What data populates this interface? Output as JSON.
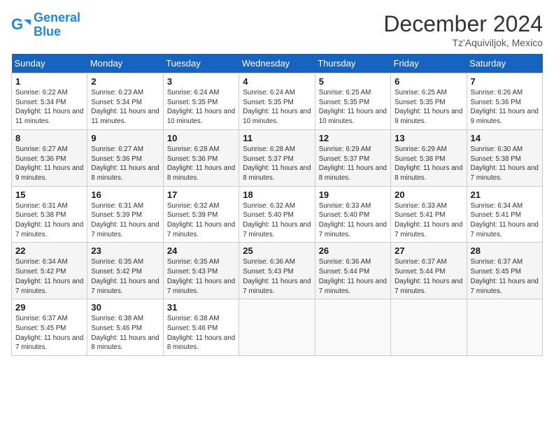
{
  "header": {
    "logo_line1": "General",
    "logo_line2": "Blue",
    "month_title": "December 2024",
    "location": "Tz'Aquiviljok, Mexico"
  },
  "days_of_week": [
    "Sunday",
    "Monday",
    "Tuesday",
    "Wednesday",
    "Thursday",
    "Friday",
    "Saturday"
  ],
  "weeks": [
    [
      {
        "day": 1,
        "sunrise": "6:22 AM",
        "sunset": "5:34 PM",
        "daylight": "11 hours and 11 minutes."
      },
      {
        "day": 2,
        "sunrise": "6:23 AM",
        "sunset": "5:34 PM",
        "daylight": "11 hours and 11 minutes."
      },
      {
        "day": 3,
        "sunrise": "6:24 AM",
        "sunset": "5:35 PM",
        "daylight": "11 hours and 10 minutes."
      },
      {
        "day": 4,
        "sunrise": "6:24 AM",
        "sunset": "5:35 PM",
        "daylight": "11 hours and 10 minutes."
      },
      {
        "day": 5,
        "sunrise": "6:25 AM",
        "sunset": "5:35 PM",
        "daylight": "11 hours and 10 minutes."
      },
      {
        "day": 6,
        "sunrise": "6:25 AM",
        "sunset": "5:35 PM",
        "daylight": "11 hours and 9 minutes."
      },
      {
        "day": 7,
        "sunrise": "6:26 AM",
        "sunset": "5:36 PM",
        "daylight": "11 hours and 9 minutes."
      }
    ],
    [
      {
        "day": 8,
        "sunrise": "6:27 AM",
        "sunset": "5:36 PM",
        "daylight": "11 hours and 9 minutes."
      },
      {
        "day": 9,
        "sunrise": "6:27 AM",
        "sunset": "5:36 PM",
        "daylight": "11 hours and 8 minutes."
      },
      {
        "day": 10,
        "sunrise": "6:28 AM",
        "sunset": "5:36 PM",
        "daylight": "11 hours and 8 minutes."
      },
      {
        "day": 11,
        "sunrise": "6:28 AM",
        "sunset": "5:37 PM",
        "daylight": "11 hours and 8 minutes."
      },
      {
        "day": 12,
        "sunrise": "6:29 AM",
        "sunset": "5:37 PM",
        "daylight": "11 hours and 8 minutes."
      },
      {
        "day": 13,
        "sunrise": "6:29 AM",
        "sunset": "5:38 PM",
        "daylight": "11 hours and 8 minutes."
      },
      {
        "day": 14,
        "sunrise": "6:30 AM",
        "sunset": "5:38 PM",
        "daylight": "11 hours and 7 minutes."
      }
    ],
    [
      {
        "day": 15,
        "sunrise": "6:31 AM",
        "sunset": "5:38 PM",
        "daylight": "11 hours and 7 minutes."
      },
      {
        "day": 16,
        "sunrise": "6:31 AM",
        "sunset": "5:39 PM",
        "daylight": "11 hours and 7 minutes."
      },
      {
        "day": 17,
        "sunrise": "6:32 AM",
        "sunset": "5:39 PM",
        "daylight": "11 hours and 7 minutes."
      },
      {
        "day": 18,
        "sunrise": "6:32 AM",
        "sunset": "5:40 PM",
        "daylight": "11 hours and 7 minutes."
      },
      {
        "day": 19,
        "sunrise": "6:33 AM",
        "sunset": "5:40 PM",
        "daylight": "11 hours and 7 minutes."
      },
      {
        "day": 20,
        "sunrise": "6:33 AM",
        "sunset": "5:41 PM",
        "daylight": "11 hours and 7 minutes."
      },
      {
        "day": 21,
        "sunrise": "6:34 AM",
        "sunset": "5:41 PM",
        "daylight": "11 hours and 7 minutes."
      }
    ],
    [
      {
        "day": 22,
        "sunrise": "6:34 AM",
        "sunset": "5:42 PM",
        "daylight": "11 hours and 7 minutes."
      },
      {
        "day": 23,
        "sunrise": "6:35 AM",
        "sunset": "5:42 PM",
        "daylight": "11 hours and 7 minutes."
      },
      {
        "day": 24,
        "sunrise": "6:35 AM",
        "sunset": "5:43 PM",
        "daylight": "11 hours and 7 minutes."
      },
      {
        "day": 25,
        "sunrise": "6:36 AM",
        "sunset": "5:43 PM",
        "daylight": "11 hours and 7 minutes."
      },
      {
        "day": 26,
        "sunrise": "6:36 AM",
        "sunset": "5:44 PM",
        "daylight": "11 hours and 7 minutes."
      },
      {
        "day": 27,
        "sunrise": "6:37 AM",
        "sunset": "5:44 PM",
        "daylight": "11 hours and 7 minutes."
      },
      {
        "day": 28,
        "sunrise": "6:37 AM",
        "sunset": "5:45 PM",
        "daylight": "11 hours and 7 minutes."
      }
    ],
    [
      {
        "day": 29,
        "sunrise": "6:37 AM",
        "sunset": "5:45 PM",
        "daylight": "11 hours and 7 minutes."
      },
      {
        "day": 30,
        "sunrise": "6:38 AM",
        "sunset": "5:46 PM",
        "daylight": "11 hours and 8 minutes."
      },
      {
        "day": 31,
        "sunrise": "6:38 AM",
        "sunset": "5:46 PM",
        "daylight": "11 hours and 8 minutes."
      },
      null,
      null,
      null,
      null
    ]
  ]
}
